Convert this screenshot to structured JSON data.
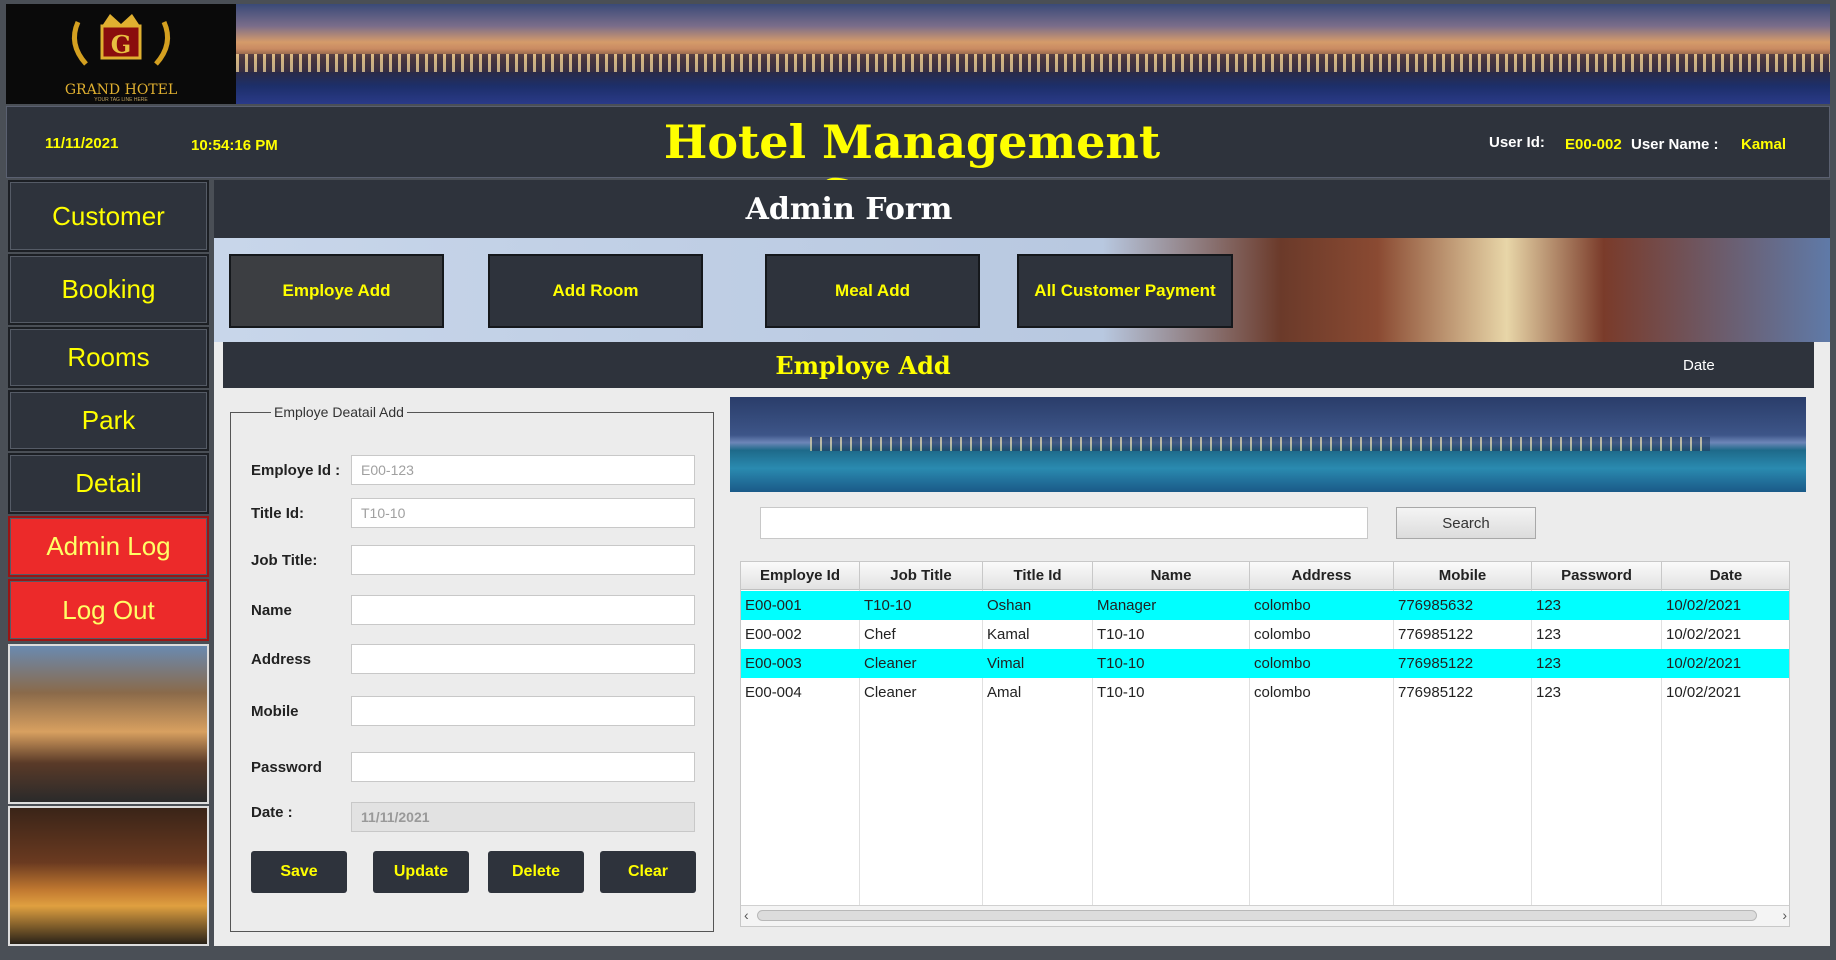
{
  "logo": {
    "brand": "GRAND HOTEL",
    "tagline": "YOUR TAG LINE HERE",
    "letter": "G"
  },
  "header": {
    "date": "11/11/2021",
    "time": "10:54:16 PM",
    "title": "Hotel Management System",
    "user_id_label": "User Id:",
    "user_id": "E00-002",
    "user_name_label": "User Name :",
    "user_name": "Kamal"
  },
  "sidebar": {
    "items": [
      {
        "label": "Customer"
      },
      {
        "label": "Booking"
      },
      {
        "label": "Rooms"
      },
      {
        "label": "Park"
      },
      {
        "label": "Detail"
      },
      {
        "label": "Admin Log"
      },
      {
        "label": "Log Out"
      }
    ]
  },
  "page_title": "Admin Form",
  "tabs": [
    {
      "label": "Employe Add"
    },
    {
      "label": "Add Room"
    },
    {
      "label": "Meal Add"
    },
    {
      "label": "All Customer Payment"
    }
  ],
  "section": {
    "title": "Employe Add",
    "date_label": "Date"
  },
  "form": {
    "legend": "Employe Deatail Add",
    "fields": [
      {
        "label": "Employe Id :",
        "value": "",
        "placeholder": "E00-123"
      },
      {
        "label": "Title Id:",
        "value": "",
        "placeholder": "T10-10"
      },
      {
        "label": "Job Title:",
        "value": "",
        "placeholder": ""
      },
      {
        "label": "Name",
        "value": "",
        "placeholder": ""
      },
      {
        "label": "Address",
        "value": "",
        "placeholder": ""
      },
      {
        "label": "Mobile",
        "value": "",
        "placeholder": ""
      },
      {
        "label": "Password",
        "value": "",
        "placeholder": ""
      },
      {
        "label": "Date :",
        "value": "11/11/2021",
        "placeholder": ""
      }
    ],
    "buttons": {
      "save": "Save",
      "update": "Update",
      "delete": "Delete",
      "clear": "Clear"
    }
  },
  "search": {
    "value": "",
    "button_label": "Search"
  },
  "table": {
    "columns": [
      "Employe Id",
      "Job Title",
      "Title Id",
      "Name",
      "Address",
      "Mobile",
      "Password",
      "Date"
    ],
    "rows": [
      [
        "E00-001",
        "T10-10",
        "Oshan",
        "Manager",
        "colombo",
        "776985632",
        "123",
        "10/02/2021"
      ],
      [
        "E00-002",
        "Chef",
        "Kamal",
        "T10-10",
        "colombo",
        "776985122",
        "123",
        "10/02/2021"
      ],
      [
        "E00-003",
        "Cleaner",
        "Vimal",
        "T10-10",
        "colombo",
        "776985122",
        "123",
        "10/02/2021"
      ],
      [
        "E00-004",
        "Cleaner",
        "Amal",
        "T10-10",
        "colombo",
        "776985122",
        "123",
        "10/02/2021"
      ]
    ],
    "highlighted_rows": [
      0,
      2
    ],
    "highlight_color": "#00ffff"
  },
  "colors": {
    "accent": "#ffff00",
    "panel": "#2e333c",
    "danger": "#ec2a2a"
  }
}
